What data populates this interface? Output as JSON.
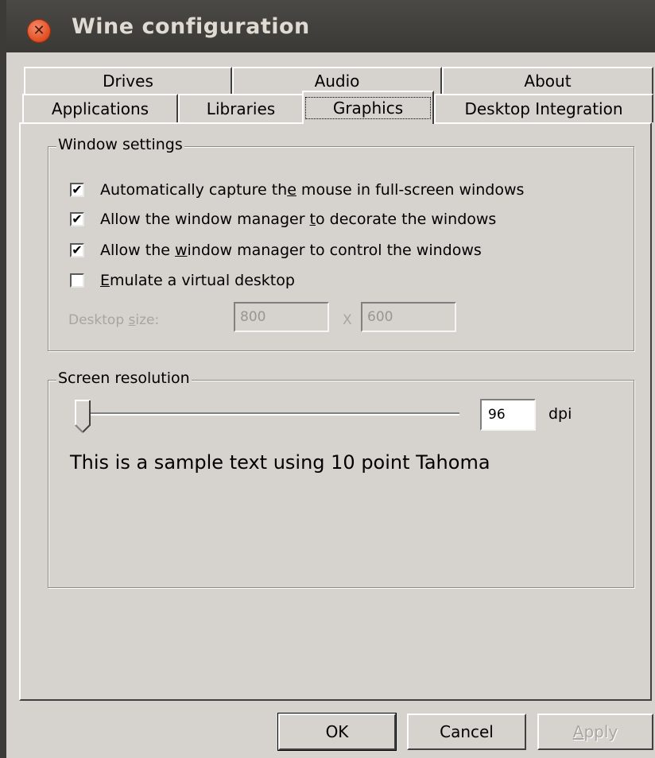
{
  "window": {
    "title": "Wine configuration"
  },
  "tabs": {
    "row1": [
      "Drives",
      "Audio",
      "About"
    ],
    "row2": [
      "Applications",
      "Libraries",
      "Graphics",
      "Desktop Integration"
    ],
    "active": "Graphics"
  },
  "window_settings": {
    "legend": "Window settings",
    "options": [
      {
        "pre": "Automatically capture th",
        "u": "e",
        "post": " mouse in full-screen windows",
        "checked": true
      },
      {
        "pre": "Allow the window manager ",
        "u": "t",
        "post": "o decorate the windows",
        "checked": true
      },
      {
        "pre": "Allow the ",
        "u": "w",
        "post": "indow manager to control the windows",
        "checked": true
      },
      {
        "pre": "",
        "u": "E",
        "post": "mulate a virtual desktop",
        "checked": false
      }
    ],
    "desktop_size_pre": "Desktop ",
    "desktop_size_u": "s",
    "desktop_size_post": "ize:",
    "width_value": "800",
    "separator": "X",
    "height_value": "600"
  },
  "screen_resolution": {
    "legend": "Screen resolution",
    "dpi_value": "96",
    "dpi_unit": "dpi",
    "slider_position": 0,
    "sample_text": "This is a sample text using 10 point Tahoma"
  },
  "buttons": {
    "ok": "OK",
    "cancel": "Cancel",
    "apply_u": "A",
    "apply_rest": "pply"
  },
  "icons": {
    "close": "close-icon"
  },
  "colors": {
    "face": "#d6d2cd",
    "titlebar": "#3c3b37",
    "close": "#df4a1e"
  }
}
